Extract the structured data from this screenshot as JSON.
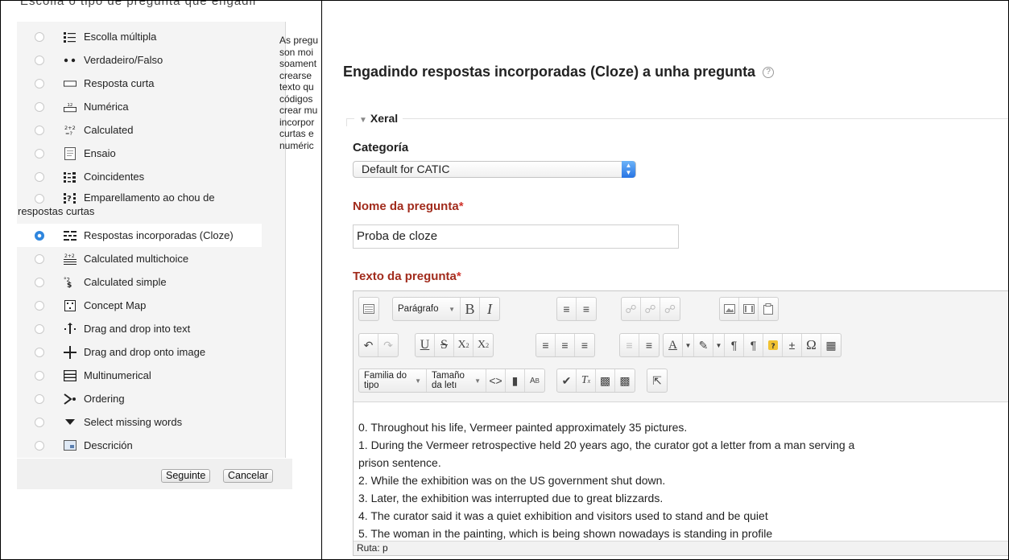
{
  "dialog": {
    "title": "Escolla o tipo de pregunta que engadir",
    "question_types": [
      {
        "label": "Escolla múltipla",
        "icon": "multichoice-icon"
      },
      {
        "label": "Verdadeiro/Falso",
        "icon": "truefalse-icon"
      },
      {
        "label": "Resposta curta",
        "icon": "shortanswer-icon"
      },
      {
        "label": "Numérica",
        "icon": "numerical-icon"
      },
      {
        "label": "Calculated",
        "icon": "calculated-icon"
      },
      {
        "label": "Ensaio",
        "icon": "essay-icon"
      },
      {
        "label": "Coincidentes",
        "icon": "match-icon"
      },
      {
        "label": "Emparellamento ao chou de",
        "label2": "respostas curtas",
        "icon": "randomsamatch-icon"
      },
      {
        "label": "Respostas incorporadas (Cloze)",
        "icon": "cloze-icon",
        "selected": true
      },
      {
        "label": "Calculated multichoice",
        "icon": "calculatedmulti-icon"
      },
      {
        "label": "Calculated simple",
        "icon": "calculatedsimple-icon"
      },
      {
        "label": "Concept Map",
        "icon": "conceptmap-icon"
      },
      {
        "label": "Drag and drop into text",
        "icon": "ddwtos-icon"
      },
      {
        "label": "Drag and drop onto image",
        "icon": "ddimageortext-icon"
      },
      {
        "label": "Multinumerical",
        "icon": "multinumerical-icon"
      },
      {
        "label": "Ordering",
        "icon": "ordering-icon"
      },
      {
        "label": "Select missing words",
        "icon": "gapselect-icon"
      },
      {
        "label": "Descrición",
        "icon": "description-icon"
      }
    ],
    "description_lines": [
      "As pregu",
      "son moi",
      "soament",
      "crearse",
      "texto qu",
      "códigos",
      "crear mu",
      "incorpor",
      "curtas e",
      "numéric"
    ],
    "next_button": "Seguinte",
    "cancel_button": "Cancelar"
  },
  "form": {
    "heading": "Engadindo respostas incorporadas (Cloze) a unha pregunta",
    "section": "Xeral",
    "category_label": "Categoría",
    "category_value": "Default for CATIC",
    "name_label": "Nome da pregunta",
    "name_value": "Proba de cloze",
    "text_label": "Texto da pregunta",
    "required_mark": "*",
    "editor": {
      "format_value": "Parágrafo",
      "font_family": "Familia do tipo",
      "font_size": "Tamaño da letı",
      "path": "Ruta: p",
      "lines": [
        "0. Throughout his life, Vermeer painted approximately 35 pictures.",
        "1. During the Vermeer retrospective held 20 years ago, the curator got a letter from a man serving a",
        "prison sentence.",
        "2. While the exhibition was on the US government shut down.",
        "3. Later, the exhibition was interrupted due to great blizzards.",
        "4. The curator said it was a quiet exhibition and visitors used to stand and be quiet",
        "5. The woman in the painting, which is being shown nowadays is standing in profile"
      ]
    }
  },
  "colors": {
    "required": "#a12b1c",
    "selected_radio": "#2f86de",
    "select_arrow": "#2874e4"
  }
}
